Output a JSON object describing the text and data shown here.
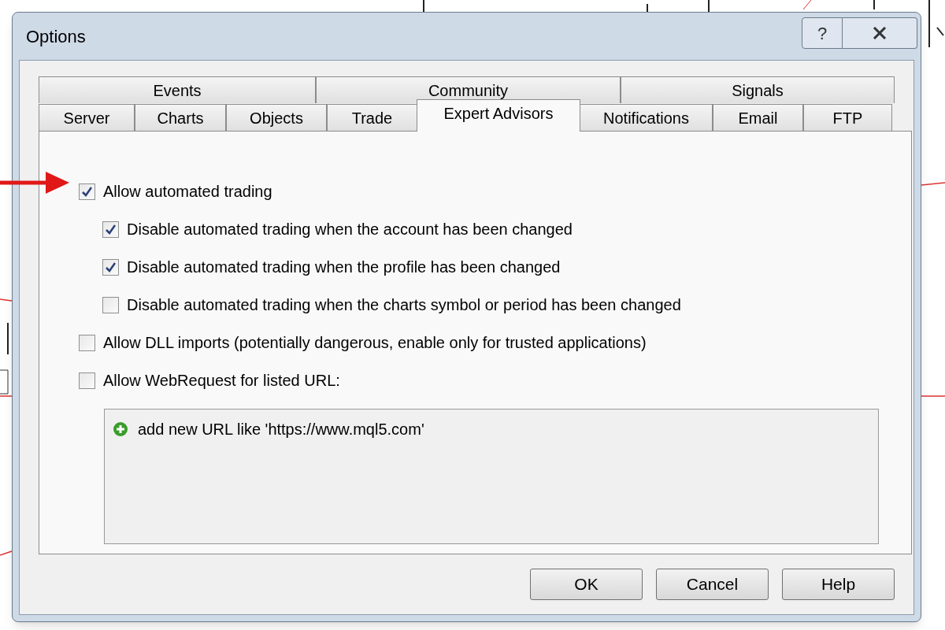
{
  "window": {
    "title": "Options",
    "help_glyph": "?"
  },
  "tab_rows": [
    [
      {
        "label": "Events",
        "selected": false
      },
      {
        "label": "Community",
        "selected": false
      },
      {
        "label": "Signals",
        "selected": false
      }
    ],
    [
      {
        "label": "Server",
        "selected": false
      },
      {
        "label": "Charts",
        "selected": false
      },
      {
        "label": "Objects",
        "selected": false
      },
      {
        "label": "Trade",
        "selected": false
      },
      {
        "label": "Expert Advisors",
        "selected": true
      },
      {
        "label": "Notifications",
        "selected": false
      },
      {
        "label": "Email",
        "selected": false
      },
      {
        "label": "FTP",
        "selected": false
      }
    ]
  ],
  "options": [
    {
      "label": "Allow automated trading",
      "checked": true,
      "children": [
        {
          "label": "Disable automated trading when the account has been changed",
          "checked": true
        },
        {
          "label": "Disable automated trading when the profile has been changed",
          "checked": true
        },
        {
          "label": "Disable automated trading when the charts symbol or period has been changed",
          "checked": false
        }
      ]
    },
    {
      "label": "Allow DLL imports (potentially dangerous, enable only for trusted applications)",
      "checked": false
    },
    {
      "label": "Allow WebRequest for listed URL:",
      "checked": false
    }
  ],
  "url_list": {
    "add_item": "add new URL like 'https://www.mql5.com'"
  },
  "buttons": [
    "OK",
    "Cancel",
    "Help"
  ]
}
